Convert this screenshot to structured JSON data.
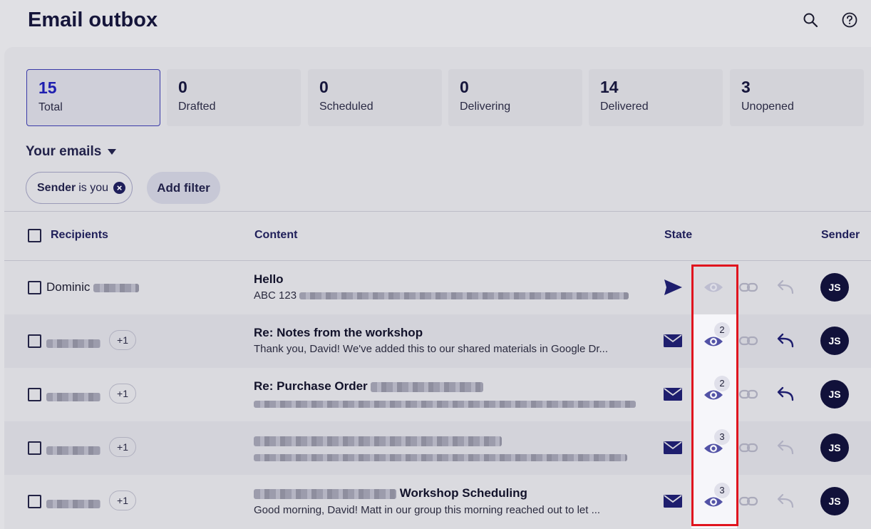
{
  "header": {
    "title": "Email outbox",
    "search_icon": "search-icon",
    "help_icon": "help-circle-icon"
  },
  "stats": [
    {
      "count": "15",
      "label": "Total",
      "active": true
    },
    {
      "count": "0",
      "label": "Drafted"
    },
    {
      "count": "0",
      "label": "Scheduled"
    },
    {
      "count": "0",
      "label": "Delivering"
    },
    {
      "count": "14",
      "label": "Delivered"
    },
    {
      "count": "3",
      "label": "Unopened"
    }
  ],
  "section": {
    "title": "Your emails"
  },
  "filters": {
    "chip_key": "Sender",
    "chip_value": "is you",
    "add_filter": "Add filter"
  },
  "table": {
    "headers": {
      "recipients": "Recipients",
      "content": "Content",
      "state": "State",
      "sender": "Sender"
    },
    "rows": [
      {
        "recipient": "Dominic",
        "extra": "",
        "subject": "Hello",
        "preview": "ABC 123",
        "state_icon": "send-icon",
        "opens": "",
        "reply": "muted",
        "sender": "JS"
      },
      {
        "recipient": "",
        "extra": "+1",
        "subject": "Re: Notes from the workshop",
        "preview": "Thank you, David! We've added this to our shared materials in Google Dr...",
        "state_icon": "envelope-icon",
        "opens": "2",
        "reply": "active",
        "sender": "JS"
      },
      {
        "recipient": "",
        "extra": "+1",
        "subject": "Re: Purchase Order",
        "preview": "",
        "state_icon": "envelope-icon",
        "opens": "2",
        "reply": "active",
        "sender": "JS"
      },
      {
        "recipient": "",
        "extra": "+1",
        "subject": "",
        "preview": "",
        "state_icon": "envelope-icon",
        "opens": "3",
        "reply": "muted",
        "sender": "JS"
      },
      {
        "recipient": "",
        "extra": "+1",
        "subject": "Workshop Scheduling",
        "preview": "Good morning, David! Matt in our group this morning reached out to let ...",
        "state_icon": "envelope-icon",
        "opens": "3",
        "reply": "muted",
        "sender": "JS"
      }
    ]
  },
  "colors": {
    "accent": "#1e1e6e",
    "highlight": "#e0141e",
    "avatar": "#11113a"
  }
}
